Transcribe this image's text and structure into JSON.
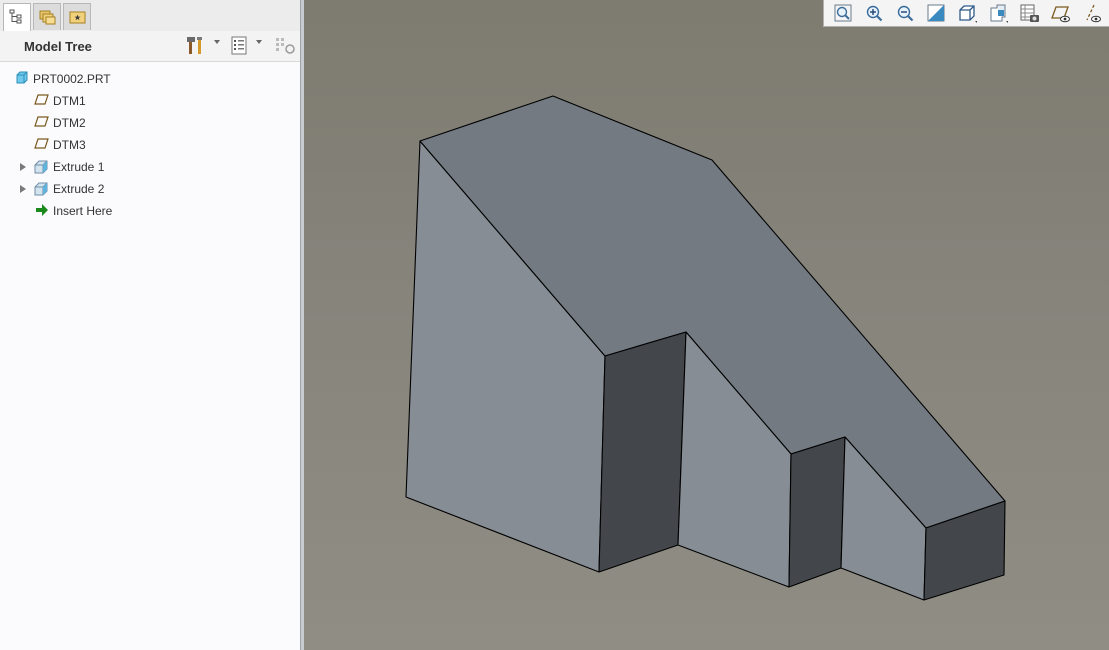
{
  "panel_tabs": [
    {
      "name": "model-tree-tab",
      "active": true
    },
    {
      "name": "folder-browser-tab",
      "active": false
    },
    {
      "name": "favorites-tab",
      "active": false
    }
  ],
  "model_tree": {
    "title": "Model Tree",
    "items": [
      {
        "label": "PRT0002.PRT",
        "icon": "part-icon",
        "expandable": false,
        "indent": 0
      },
      {
        "label": "DTM1",
        "icon": "datum-plane-icon",
        "expandable": false,
        "indent": 1
      },
      {
        "label": "DTM2",
        "icon": "datum-plane-icon",
        "expandable": false,
        "indent": 1
      },
      {
        "label": "DTM3",
        "icon": "datum-plane-icon",
        "expandable": false,
        "indent": 1
      },
      {
        "label": "Extrude 1",
        "icon": "extrude-icon",
        "expandable": true,
        "indent": 1
      },
      {
        "label": "Extrude 2",
        "icon": "extrude-icon",
        "expandable": true,
        "indent": 1
      },
      {
        "label": "Insert Here",
        "icon": "insert-arrow-icon",
        "expandable": false,
        "indent": 1
      }
    ]
  },
  "view_toolbar": [
    "refit-icon",
    "zoom-in-icon",
    "zoom-out-icon",
    "repaint-icon",
    "display-style-icon",
    "saved-orientations-icon",
    "view-manager-icon",
    "perspective-icon",
    "datum-display-icon",
    "annotation-display-icon"
  ],
  "colors": {
    "viewport_bg": "#85837a",
    "top_face": "#737a82",
    "left_face": "#878d95",
    "dark_face": "#43464b",
    "insert_arrow": "#1a8a1a"
  }
}
